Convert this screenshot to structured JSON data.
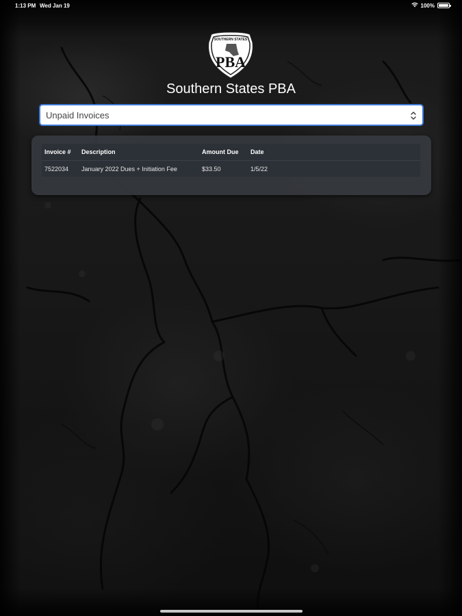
{
  "status_bar": {
    "time": "1:13 PM",
    "date": "Wed Jan 19",
    "battery": "100%",
    "battery_level": 1.0
  },
  "logo": {
    "arc_text": "SOUTHERN STATES",
    "letters": "PBA"
  },
  "app_title": "Southern States PBA",
  "invoice_filter": {
    "selected": "Unpaid Invoices"
  },
  "invoice_table": {
    "columns": [
      "Invoice #",
      "Description",
      "Amount Due",
      "Date"
    ],
    "rows": [
      {
        "invoice_number": "7522034",
        "description": "January 2022 Dues + Initiation Fee",
        "amount_due": "$33.50",
        "date": "1/5/22"
      }
    ]
  },
  "colors": {
    "accent_border": "#3e7bd8",
    "card_background": "#36393e",
    "table_background": "#2c3037"
  }
}
